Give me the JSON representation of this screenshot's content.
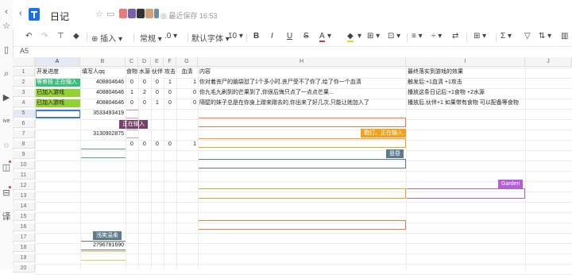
{
  "app": {
    "title": "日记",
    "saved_status": "最近保存 16:53",
    "name_box": "A5"
  },
  "sidebar_icons": [
    "back-arrow-icon",
    "star-icon",
    "book-icon",
    "search-icon",
    "video-icon",
    "live-icon",
    "chat-icon",
    "bag-icon",
    "cart-icon",
    "translate-icon"
  ],
  "toolbar": {
    "insert_label": "插入",
    "format_label": "常规",
    "decimal_label": ".0",
    "font_label": "默认字体",
    "size_label": "10"
  },
  "columns": [
    "A",
    "B",
    "C",
    "D",
    "E",
    "F",
    "G",
    "H",
    "I",
    "J"
  ],
  "rows": [
    "1",
    "2",
    "3",
    "4",
    "5",
    "6",
    "7",
    "8",
    "9",
    "10",
    "11",
    "12",
    "13",
    "14",
    "15",
    "16",
    "17",
    "18",
    "19",
    "20"
  ],
  "header_row": {
    "a": "开发进度",
    "b": "填写人qq",
    "c": "食物",
    "d": "水源",
    "e": "伙伴",
    "f": "攻击",
    "g": "血清",
    "h": "内容",
    "i": "最终落实到游戏的效果"
  },
  "data_rows": [
    {
      "a": "等审核 正在输入",
      "b": "408804646",
      "c": "0",
      "d": "0",
      "e": "0",
      "f": "1",
      "g": "1",
      "h": "你对着丧尸的脑袋怼了1个多小时,丧尸受不了你了,给了你一个血清",
      "i": "触发后:+1血清 +1攻击"
    },
    {
      "a": "已加入游戏",
      "b": "408804646",
      "c": "1",
      "d": "2",
      "e": "0",
      "f": "0",
      "g": "0",
      "h": "你九毛九刷到的芒果到了,你很后悔只点了一点点芒果...",
      "i": "播放这条日记后:+1食物 +2水源"
    },
    {
      "a": "已加入游戏",
      "b": "408804646",
      "c": "0",
      "d": "0",
      "e": "1",
      "f": "0",
      "g": "0",
      "h": "隔壁的妹子总是在你身上蹭来蹭去的,你出来了好几次,只能让她加入了",
      "i": "播放后,伙伴+1 如果带有食物 可以配备等食物"
    }
  ],
  "b5": "3533493419",
  "b7": "3130902875",
  "row8": {
    "c": "0",
    "d": "0",
    "e": "0",
    "f": "0",
    "g": "1"
  },
  "b18": "2796781690",
  "badges": {
    "typing": "正在输入",
    "typing2": "戳灯、正在输入",
    "gray": "昙昼",
    "garden": "Garden",
    "user": "浅笑温柔"
  },
  "colors": {
    "green_badge": "#3cbf7c",
    "lime": "#92d036",
    "purple_badge": "#7a3f6b",
    "orange": "#f0a21c",
    "slate": "#5d7b8a",
    "violet": "#b45fd8",
    "brown": "#d9804c",
    "teal": "#4fa98a",
    "selection": "#3c78d8"
  }
}
